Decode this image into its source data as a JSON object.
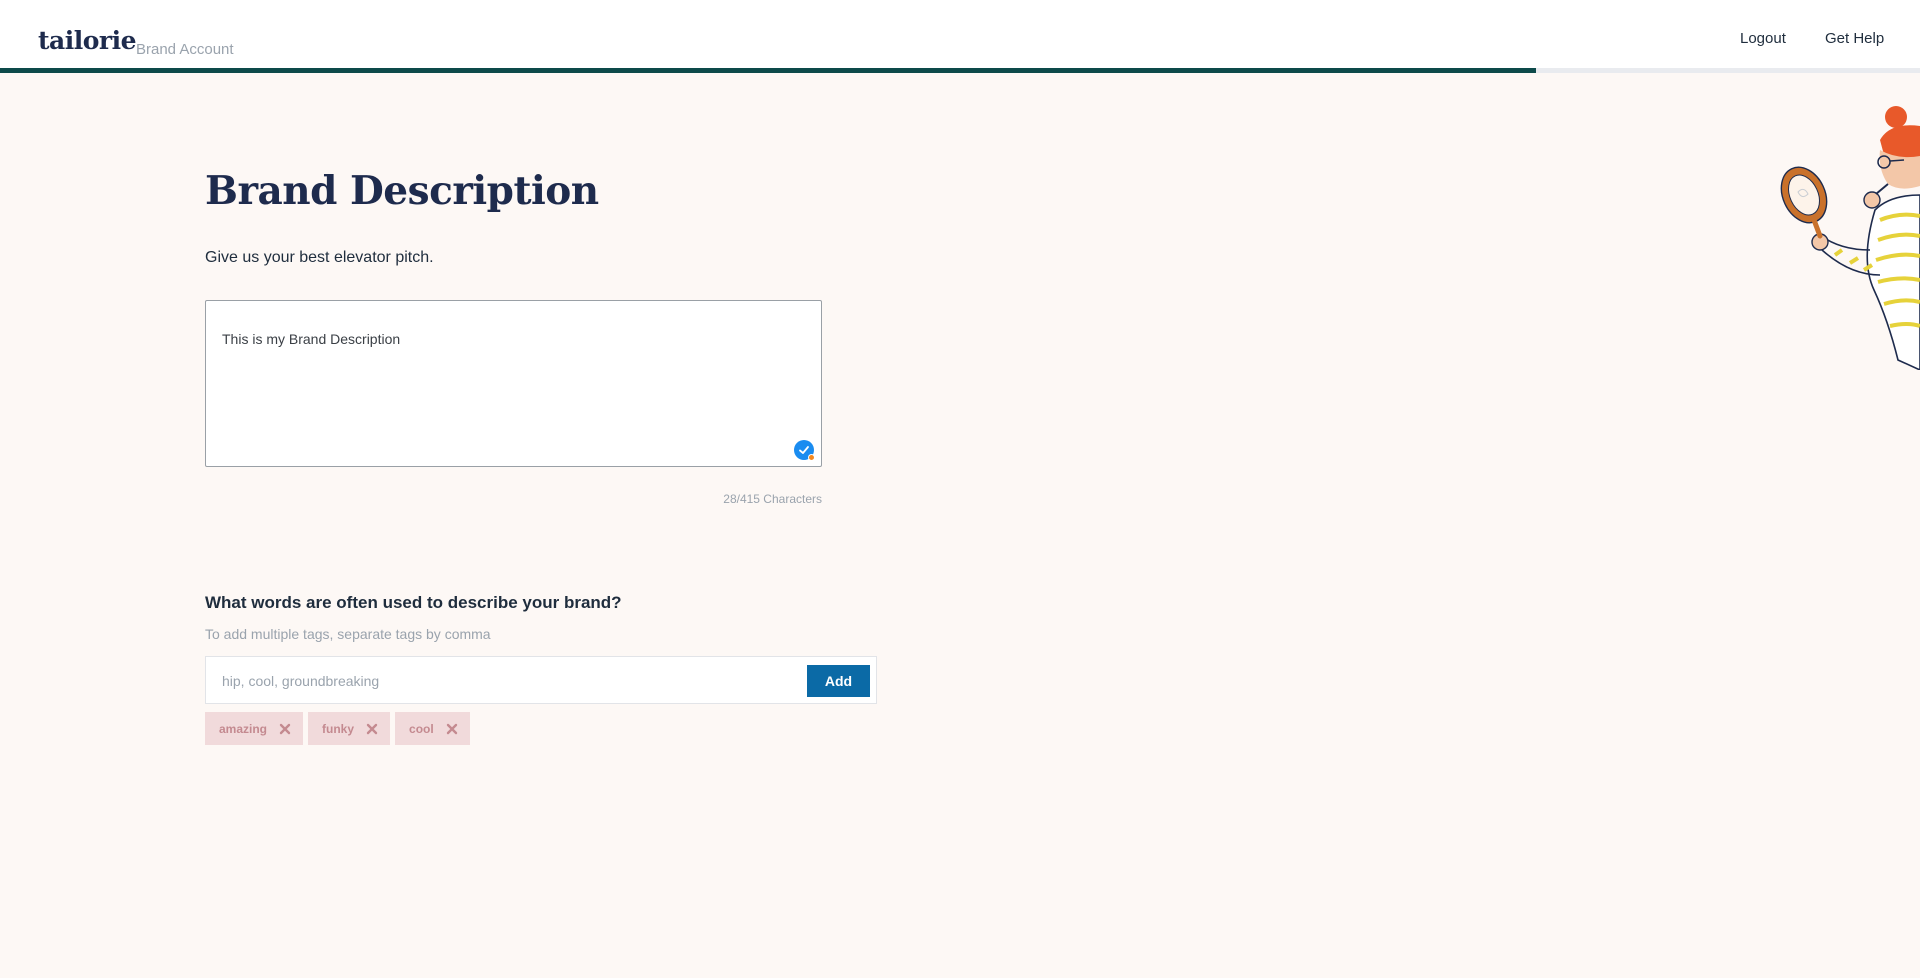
{
  "header": {
    "logo": "tailorie",
    "account_label": "Brand Account",
    "nav": {
      "logout": "Logout",
      "get_help": "Get Help"
    },
    "progress_fraction": 0.8
  },
  "main": {
    "title": "Brand Description",
    "subtitle": "Give us your best elevator pitch.",
    "description_value": "This is my Brand Description",
    "char_count": "28/415 Characters",
    "tags_question": "What words are often used to describe your brand?",
    "tags_hint": "To add multiple tags, separate tags by comma",
    "tag_input_placeholder": "hip, cool, groundbreaking",
    "add_label": "Add",
    "tags": [
      "amazing",
      "funky",
      "cool"
    ]
  },
  "colors": {
    "accent_dark_teal": "#0d4a4a",
    "primary_button": "#0b6aa6",
    "tag_background": "#f1dadb",
    "tag_text": "#c48a90",
    "page_background": "#fdf8f5"
  }
}
